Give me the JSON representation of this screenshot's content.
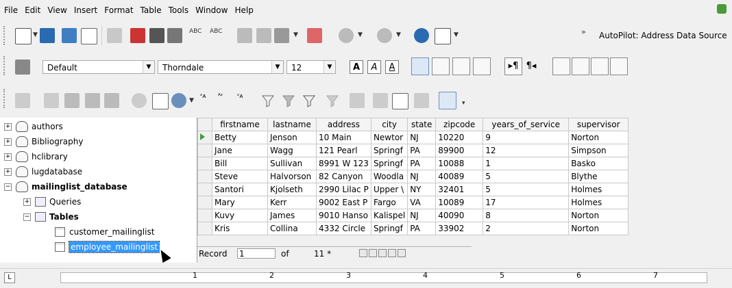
{
  "menu": [
    "File",
    "Edit",
    "View",
    "Insert",
    "Format",
    "Table",
    "Tools",
    "Window",
    "Help"
  ],
  "toolbar1": {
    "autopilot_label": "AutoPilot: Address Data Source"
  },
  "toolbar2": {
    "style": "Default",
    "font": "Thorndale",
    "size": "12",
    "bold": "A",
    "italic": "A",
    "underline": "A"
  },
  "tree": {
    "items": [
      {
        "label": "authors",
        "expander": "+"
      },
      {
        "label": "Bibliography",
        "expander": "+"
      },
      {
        "label": "hclibrary",
        "expander": "+"
      },
      {
        "label": "lugdatabase",
        "expander": "+"
      },
      {
        "label": "mailinglist_database",
        "expander": "−"
      }
    ],
    "queries": "Queries",
    "tables": "Tables",
    "table_items": [
      "customer_mailinglist",
      "employee_mailinglist"
    ]
  },
  "grid": {
    "columns": [
      "firstname",
      "lastname",
      "address",
      "city",
      "state",
      "zipcode",
      "years_of_service",
      "supervisor"
    ],
    "rows": [
      [
        "Betty",
        "Jenson",
        "10 Main",
        "Newtor",
        "NJ",
        "10220",
        "9",
        "Norton"
      ],
      [
        "Jane",
        "Wagg",
        "121 Pearl",
        "Springf",
        "PA",
        "89900",
        "12",
        "Simpson"
      ],
      [
        "Bill",
        "Sullivan",
        "8991 W 123",
        "Springf",
        "PA",
        "10088",
        "1",
        "Basko"
      ],
      [
        "Steve",
        "Halvorson",
        "82 Canyon",
        "Woodla",
        "NJ",
        "40089",
        "5",
        "Blythe"
      ],
      [
        "Santori",
        "Kjolseth",
        "2990 Lilac P",
        "Upper \\",
        "NY",
        "32401",
        "5",
        "Holmes"
      ],
      [
        "Mary",
        "Kerr",
        "9002 East P",
        "Fargo",
        "VA",
        "10089",
        "17",
        "Holmes"
      ],
      [
        "Kuvy",
        "James",
        "9010 Hanso",
        "Kalispel",
        "NJ",
        "40090",
        "8",
        "Norton"
      ],
      [
        "Kris",
        "Collina",
        "4332 Circle",
        "Springf",
        "PA",
        "33902",
        "2",
        "Norton"
      ]
    ]
  },
  "navbar": {
    "record_label": "Record",
    "record_value": "1",
    "of_label": "of",
    "count": "11 *"
  },
  "ruler": {
    "numbers": [
      "1",
      "2",
      "3",
      "4",
      "5",
      "6",
      "7"
    ]
  }
}
